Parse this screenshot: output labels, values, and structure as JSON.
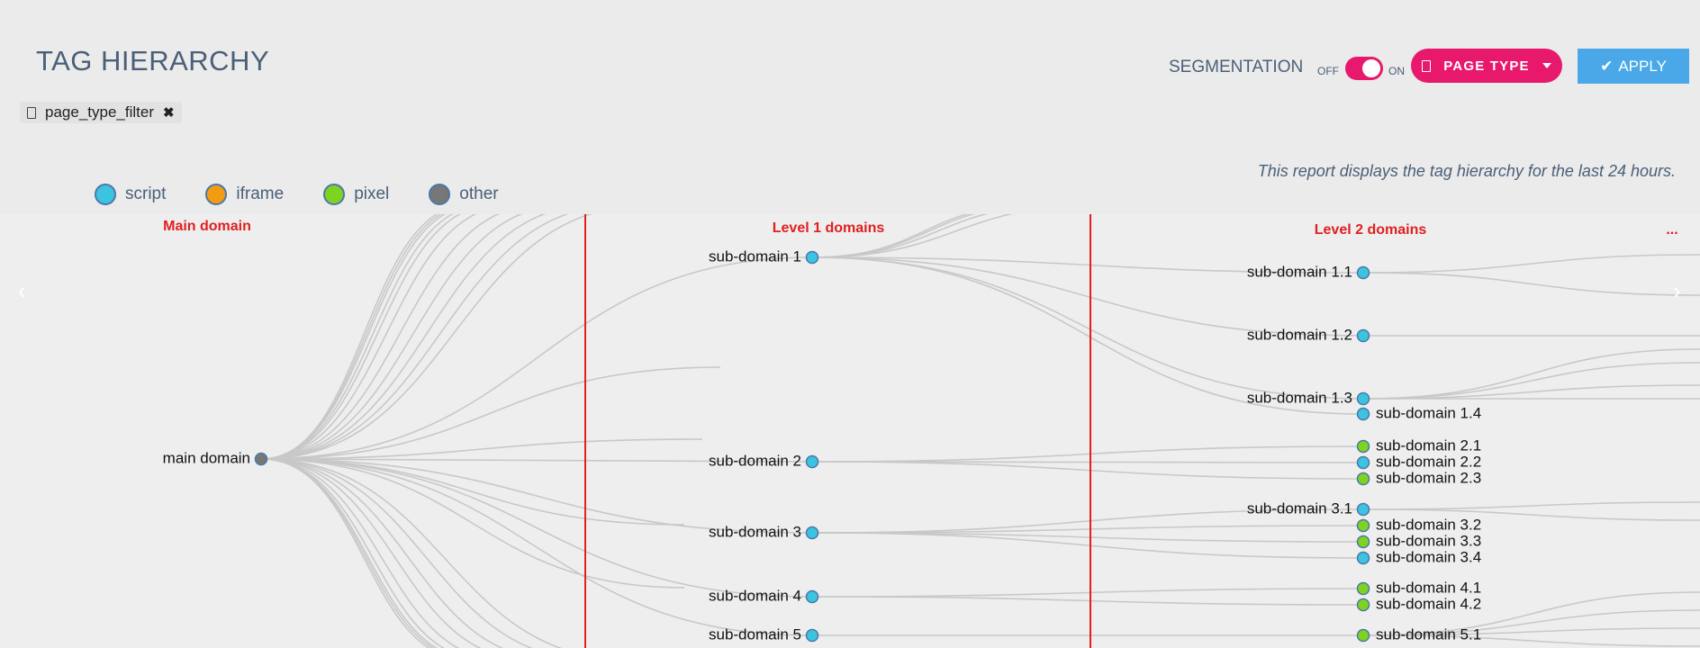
{
  "header": {
    "title": "TAG HIERARCHY",
    "filter_chip": "page_type_filter",
    "segmentation_label": "SEGMENTATION",
    "toggle_off": "OFF",
    "toggle_on": "ON",
    "toggle_state": "on",
    "page_type_button": "PAGE TYPE",
    "apply_button": "APPLY",
    "report_note": "This report displays the tag hierarchy for the last 24 hours."
  },
  "legend": [
    {
      "label": "script",
      "color": "#3cc3e0"
    },
    {
      "label": "iframe",
      "color": "#f39c12"
    },
    {
      "label": "pixel",
      "color": "#7ed321"
    },
    {
      "label": "other",
      "color": "#777777"
    }
  ],
  "columns": {
    "main": "Main domain",
    "level1": "Level 1 domains",
    "level2": "Level 2 domains",
    "more": "..."
  },
  "nodes": {
    "main": {
      "label": "main domain",
      "type": "other"
    },
    "level1": [
      {
        "label": "sub-domain 1",
        "type": "script"
      },
      {
        "label": "sub-domain 2",
        "type": "script"
      },
      {
        "label": "sub-domain 3",
        "type": "script"
      },
      {
        "label": "sub-domain 4",
        "type": "script"
      },
      {
        "label": "sub-domain 5",
        "type": "script"
      }
    ],
    "level2": [
      {
        "label": "sub-domain 1.1",
        "type": "script",
        "parent": 0,
        "side": "left"
      },
      {
        "label": "sub-domain 1.2",
        "type": "script",
        "parent": 0,
        "side": "left"
      },
      {
        "label": "sub-domain 1.3",
        "type": "script",
        "parent": 0,
        "side": "left"
      },
      {
        "label": "sub-domain 1.4",
        "type": "script",
        "parent": 0,
        "side": "right"
      },
      {
        "label": "sub-domain 2.1",
        "type": "pixel",
        "parent": 1,
        "side": "right"
      },
      {
        "label": "sub-domain 2.2",
        "type": "script",
        "parent": 1,
        "side": "right"
      },
      {
        "label": "sub-domain 2.3",
        "type": "pixel",
        "parent": 1,
        "side": "right"
      },
      {
        "label": "sub-domain 3.1",
        "type": "script",
        "parent": 2,
        "side": "left"
      },
      {
        "label": "sub-domain 3.2",
        "type": "pixel",
        "parent": 2,
        "side": "right"
      },
      {
        "label": "sub-domain 3.3",
        "type": "pixel",
        "parent": 2,
        "side": "right"
      },
      {
        "label": "sub-domain 3.4",
        "type": "script",
        "parent": 2,
        "side": "right"
      },
      {
        "label": "sub-domain 4.1",
        "type": "pixel",
        "parent": 3,
        "side": "right"
      },
      {
        "label": "sub-domain 4.2",
        "type": "pixel",
        "parent": 3,
        "side": "right"
      },
      {
        "label": "sub-domain 5.1",
        "type": "pixel",
        "parent": 4,
        "side": "right"
      }
    ]
  }
}
